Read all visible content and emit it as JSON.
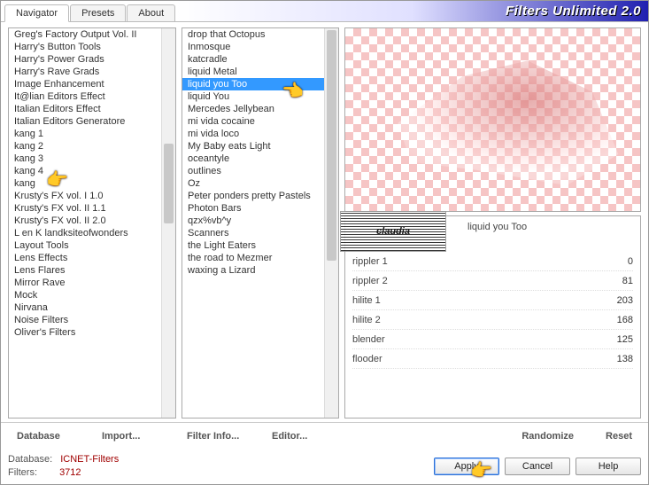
{
  "title": "Filters Unlimited 2.0",
  "tabs": [
    "Navigator",
    "Presets",
    "About"
  ],
  "active_tab": 0,
  "categories": [
    "Greg's Factory Output Vol. II",
    "Harry's Button Tools",
    "Harry's Power Grads",
    "Harry's Rave Grads",
    "Image Enhancement",
    "It@lian Editors Effect",
    "Italian Editors Effect",
    "Italian Editors Generatore",
    "kang 1",
    "kang 2",
    "kang 3",
    "kang 4",
    "kang",
    "Krusty's FX vol. I 1.0",
    "Krusty's FX vol. II 1.1",
    "Krusty's FX vol. II 2.0",
    "L en K landksiteofwonders",
    "Layout Tools",
    "Lens Effects",
    "Lens Flares",
    "Mirror Rave",
    "Mock",
    "Nirvana",
    "Noise Filters",
    "Oliver's Filters"
  ],
  "category_selected_index": 10,
  "filters": [
    "drop that Octopus",
    "Inmosque",
    "katcradle",
    "liquid Metal",
    "liquid you Too",
    "liquid You",
    "Mercedes Jellybean",
    "mi vida cocaine",
    "mi vida loco",
    "My Baby eats Light",
    "oceantyle",
    "outlines",
    "Oz",
    "Peter ponders pretty Pastels",
    "Photon Bars",
    "qzx%vb^y",
    "Scanners",
    "the Light Eaters",
    "the road to Mezmer",
    "waxing a Lizard"
  ],
  "filter_selected_index": 4,
  "current_filter": "liquid you Too",
  "watermark": "claudia",
  "params": [
    {
      "label": "rippler 1",
      "value": 0
    },
    {
      "label": "rippler 2",
      "value": 81
    },
    {
      "label": "hilite 1",
      "value": 203
    },
    {
      "label": "hilite 2",
      "value": 168
    },
    {
      "label": "blender",
      "value": 125
    },
    {
      "label": "flooder",
      "value": 138
    }
  ],
  "mid_buttons": {
    "database": "Database",
    "import": "Import...",
    "filter_info": "Filter Info...",
    "editor": "Editor...",
    "randomize": "Randomize",
    "reset": "Reset"
  },
  "bottom_buttons": {
    "apply": "Apply",
    "cancel": "Cancel",
    "help": "Help"
  },
  "footer": {
    "db_label": "Database:",
    "db_value": "ICNET-Filters",
    "filters_label": "Filters:",
    "filters_value": "3712"
  }
}
